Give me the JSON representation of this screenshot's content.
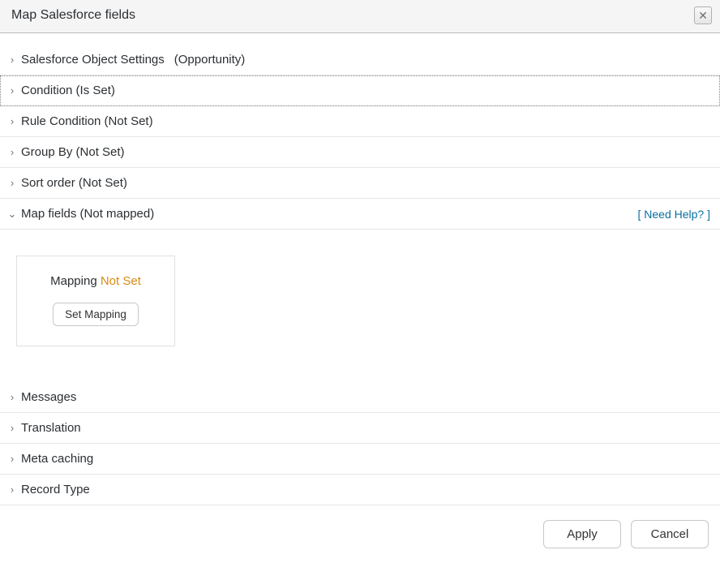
{
  "dialog": {
    "title": "Map Salesforce fields",
    "close_tooltip": "Close"
  },
  "sections": {
    "object_settings": {
      "label": "Salesforce Object Settings",
      "extra": "(Opportunity)",
      "expanded": false
    },
    "condition": {
      "label": "Condition (Is Set)",
      "expanded": false,
      "selected": true
    },
    "rule_condition": {
      "label": "Rule Condition (Not Set)",
      "expanded": false
    },
    "group_by": {
      "label": "Group By (Not Set)",
      "expanded": false
    },
    "sort_order": {
      "label": "Sort order (Not Set)",
      "expanded": false
    },
    "map_fields": {
      "label": "Map fields (Not mapped)",
      "expanded": true,
      "help_link": "[ Need Help? ]"
    },
    "messages": {
      "label": "Messages",
      "expanded": false
    },
    "translation": {
      "label": "Translation",
      "expanded": false
    },
    "meta_caching": {
      "label": "Meta caching",
      "expanded": false
    },
    "record_type": {
      "label": "Record Type",
      "expanded": false
    }
  },
  "mapping_card": {
    "label": "Mapping",
    "status": "Not Set",
    "button": "Set Mapping"
  },
  "footer": {
    "apply": "Apply",
    "cancel": "Cancel"
  },
  "glyphs": {
    "chevron_right": "›",
    "chevron_down": "⌄",
    "close_x": "✕"
  }
}
